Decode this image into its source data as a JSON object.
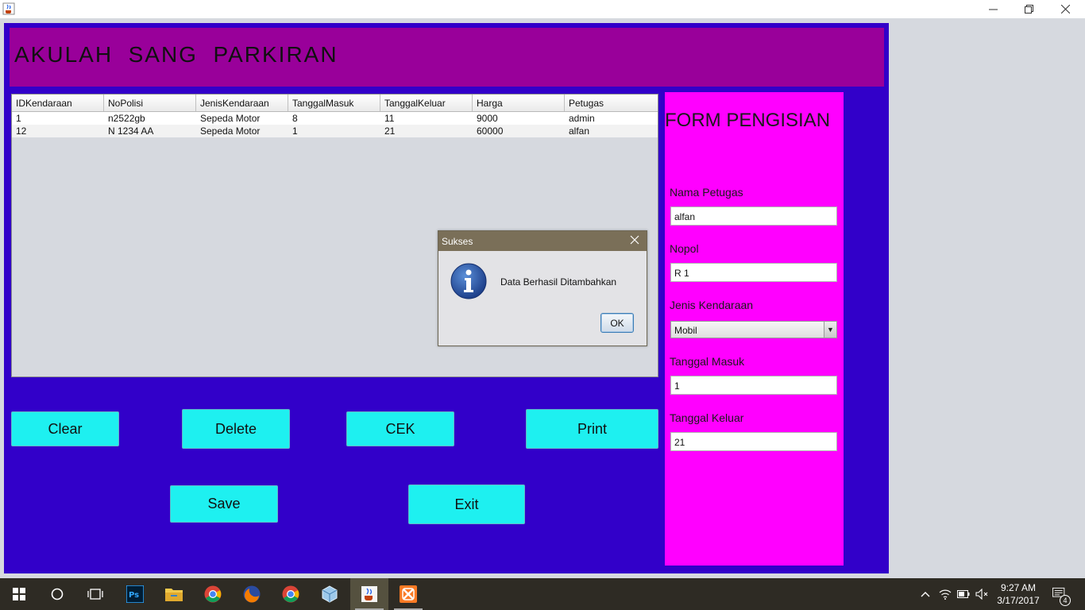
{
  "window": {
    "app_icon": "java-cup-icon",
    "controls": [
      "minimize-icon",
      "restore-icon",
      "close-icon"
    ]
  },
  "header": {
    "title": "AKULAH  SANG  PARKIRAN"
  },
  "table": {
    "columns": [
      "IDKendaraan",
      "NoPolisi",
      "JenisKendaraan",
      "TanggalMasuk",
      "TanggalKeluar",
      "Harga",
      "Petugas"
    ],
    "rows": [
      [
        "1",
        "n2522gb",
        "Sepeda Motor",
        "8",
        "11",
        "9000",
        "admin"
      ],
      [
        "12",
        "N 1234 AA",
        "Sepeda Motor",
        "1",
        "21",
        "60000",
        "alfan"
      ]
    ]
  },
  "buttons": {
    "clear": "Clear",
    "delete": "Delete",
    "cek": "CEK",
    "print": "Print",
    "save": "Save",
    "exit": "Exit"
  },
  "form": {
    "title": "FORM PENGISIAN",
    "nama_petugas_label": "Nama Petugas",
    "nama_petugas_value": "alfan",
    "nopol_label": "Nopol",
    "nopol_value": "R 1",
    "jenis_label": "Jenis Kendaraan",
    "jenis_value": "Mobil",
    "tanggal_masuk_label": "Tanggal Masuk",
    "tanggal_masuk_value": "1",
    "tanggal_keluar_label": "Tanggal Keluar",
    "tanggal_keluar_value": "21"
  },
  "dialog": {
    "title": "Sukses",
    "message": "Data Berhasil Ditambahkan",
    "ok_label": "OK",
    "icon": "info-icon"
  },
  "taskbar": {
    "time": "9:27 AM",
    "date": "3/17/2017",
    "notification_count": "4"
  },
  "colors": {
    "frame": "#3200c9",
    "header": "#99009a",
    "form_panel": "#ff00ff",
    "button": "#1ef0f0",
    "dialog_title": "#7a6f58"
  }
}
